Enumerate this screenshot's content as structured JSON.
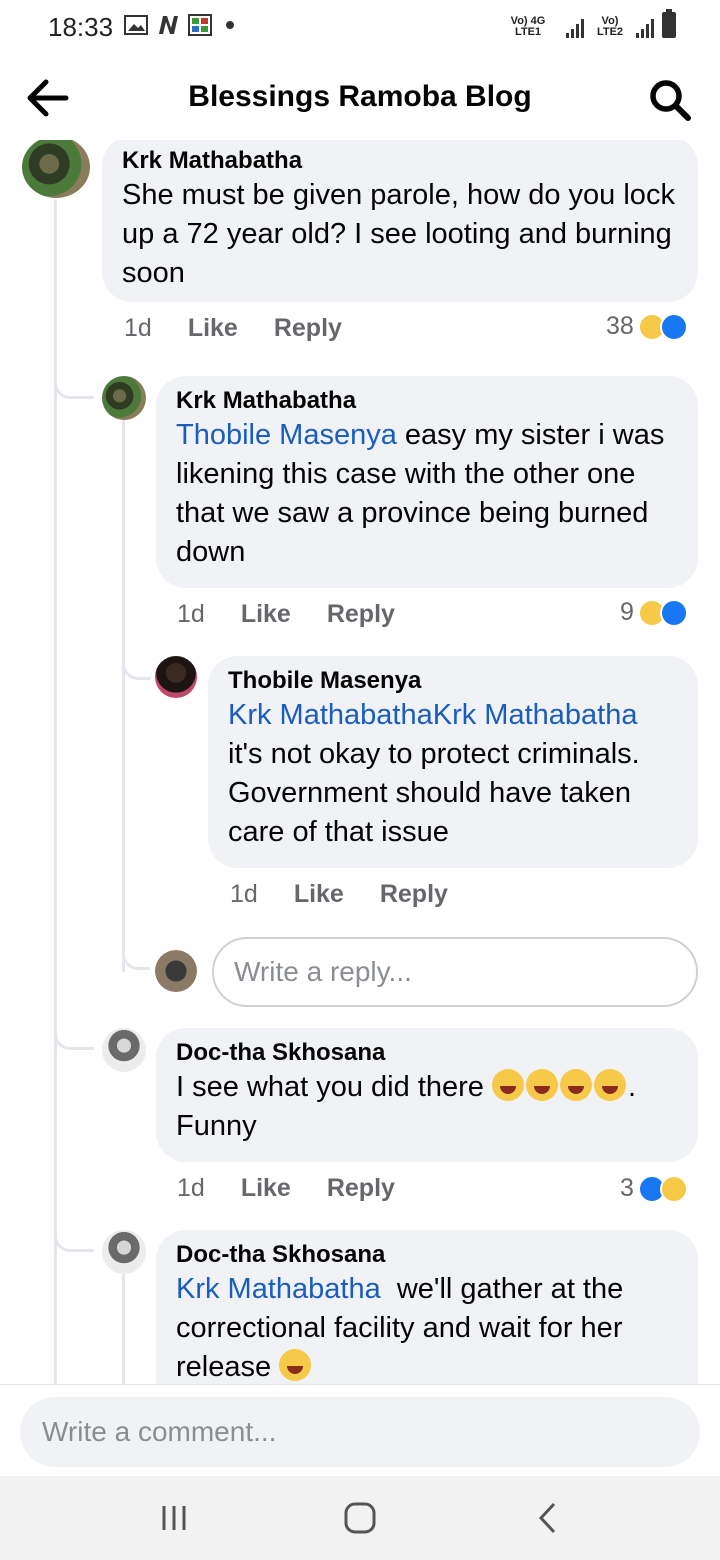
{
  "status_bar": {
    "time": "18:33",
    "sim1": "Vo) 4G LTE1",
    "sim2": "Vo) LTE2"
  },
  "header": {
    "title": "Blessings Ramoba Blog",
    "back_icon": "arrow-left-icon",
    "search_icon": "search-icon"
  },
  "comments": [
    {
      "author": "Krk Mathabatha",
      "text": "She must be given parole, how do you lock up a 72 year old? I see looting and burning soon",
      "time": "1d",
      "like_label": "Like",
      "reply_label": "Reply",
      "reaction_count": "38"
    },
    {
      "author": "Krk Mathabatha",
      "mention": "Thobile Masenya",
      "text": " easy my sister i was likening this case with the other one that we saw a province being burned down",
      "time": "1d",
      "like_label": "Like",
      "reply_label": "Reply",
      "reaction_count": "9"
    },
    {
      "author": "Thobile Masenya",
      "mention": "Krk MathabathaKrk Mathabatha",
      "text": "it's not okay to protect criminals. Government should have taken care of that issue",
      "time": "1d",
      "like_label": "Like",
      "reply_label": "Reply"
    },
    {
      "author": "Doc-tha Skhosana",
      "text_before": "I see what you did there ",
      "text_after": ". Funny",
      "time": "1d",
      "like_label": "Like",
      "reply_label": "Reply",
      "reaction_count": "3"
    },
    {
      "author": "Doc-tha Skhosana",
      "mention": "Krk Mathabatha",
      "text": "  we'll gather at the correctional facility and wait for her release "
    }
  ],
  "reply_input": {
    "placeholder": "Write a reply..."
  },
  "comment_input": {
    "placeholder": "Write a comment..."
  },
  "colors": {
    "bubble": "#f0f2f5",
    "mention": "#1a5dbd",
    "meta": "#65676b",
    "like_blue": "#1877f2",
    "haha_yellow": "#f7c948"
  }
}
